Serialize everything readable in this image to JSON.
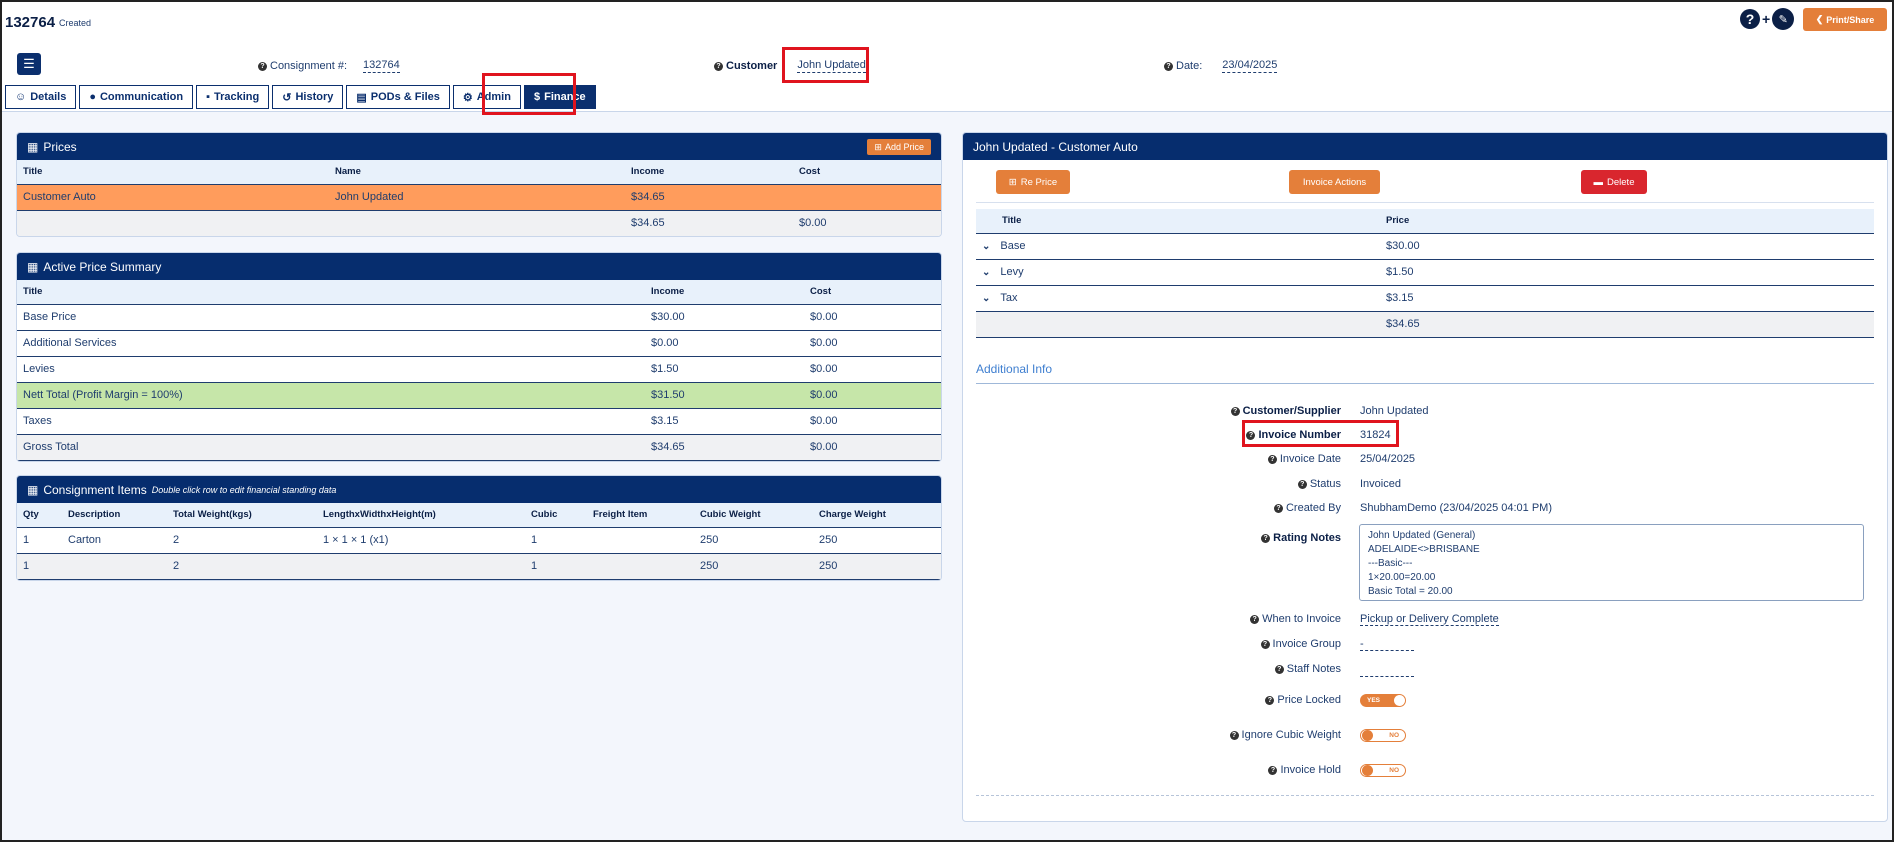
{
  "header": {
    "consignment_id": "132764",
    "status": "Created",
    "print_label": "Print/Share",
    "consignment_label": "Consignment #:",
    "consignment_value": "132764",
    "customer_label": "Customer",
    "customer_value": "John Updated",
    "date_label": "Date:",
    "date_value": "23/04/2025"
  },
  "tabs": [
    "Details",
    "Communication",
    "Tracking",
    "History",
    "PODs & Files",
    "Admin",
    "Finance"
  ],
  "prices": {
    "title": "Prices",
    "add_label": "Add Price",
    "headers": [
      "Title",
      "Name",
      "Income",
      "Cost"
    ],
    "rows": [
      [
        "Customer Auto",
        "John Updated",
        "$34.65",
        ""
      ],
      [
        "",
        "",
        "$34.65",
        "$0.00"
      ]
    ]
  },
  "summary": {
    "title": "Active Price Summary",
    "headers": [
      "Title",
      "Income",
      "Cost"
    ],
    "rows": [
      [
        "Base Price",
        "$30.00",
        "$0.00"
      ],
      [
        "Additional Services",
        "$0.00",
        "$0.00"
      ],
      [
        "Levies",
        "$1.50",
        "$0.00"
      ],
      [
        "Nett Total (Profit Margin = 100%)",
        "$31.50",
        "$0.00"
      ],
      [
        "Taxes",
        "$3.15",
        "$0.00"
      ],
      [
        "Gross Total",
        "$34.65",
        "$0.00"
      ]
    ]
  },
  "items": {
    "title": "Consignment Items",
    "subtitle": "Double click row to edit financial standing data",
    "headers": [
      "Qty",
      "Description",
      "Total Weight(kgs)",
      "LengthxWidthxHeight(m)",
      "Cubic",
      "Freight Item",
      "Cubic Weight",
      "Charge Weight"
    ],
    "rows": [
      [
        "1",
        "Carton",
        "2",
        "1 × 1 × 1 (x1)",
        "1",
        "",
        "250",
        "250"
      ],
      [
        "1",
        "",
        "2",
        "",
        "1",
        "",
        "250",
        "250"
      ]
    ]
  },
  "detail": {
    "title": "John Updated - Customer Auto",
    "reprice_label": "Re Price",
    "invoice_actions_label": "Invoice Actions",
    "delete_label": "Delete",
    "headers": [
      "Title",
      "Price"
    ],
    "rows": [
      [
        "Base",
        "$30.00"
      ],
      [
        "Levy",
        "$1.50"
      ],
      [
        "Tax",
        "$3.15"
      ],
      [
        "",
        "$34.65"
      ]
    ],
    "additional_info_title": "Additional Info",
    "customer_supplier_label": "Customer/Supplier",
    "customer_supplier_value": "John Updated",
    "invoice_number_label": "Invoice Number",
    "invoice_number_value": "31824",
    "invoice_date_label": "Invoice Date",
    "invoice_date_value": "25/04/2025",
    "status_label": "Status",
    "status_value": "Invoiced",
    "created_by_label": "Created By",
    "created_by_value": "ShubhamDemo (23/04/2025 04:01 PM)",
    "rating_notes_label": "Rating Notes",
    "rating_notes_value": "John Updated (General)\nADELAIDE<>BRISBANE\n---Basic---\n1×20.00=20.00\nBasic Total = 20.00",
    "when_to_invoice_label": "When to Invoice",
    "when_to_invoice_value": "Pickup or Delivery Complete",
    "invoice_group_label": "Invoice Group",
    "invoice_group_value": "-",
    "staff_notes_label": "Staff Notes",
    "staff_notes_value": "",
    "price_locked_label": "Price Locked",
    "price_locked_value": "YES",
    "ignore_cubic_label": "Ignore Cubic Weight",
    "ignore_cubic_value": "NO",
    "invoice_hold_label": "Invoice Hold",
    "invoice_hold_value": "NO"
  },
  "colors": {
    "navy": "#062d6e",
    "orange": "#e47f3a",
    "orange_row": "#ff9c5c",
    "green_row": "#c6e6a9",
    "delete": "#d9262e",
    "highlight": "#e0141e"
  }
}
